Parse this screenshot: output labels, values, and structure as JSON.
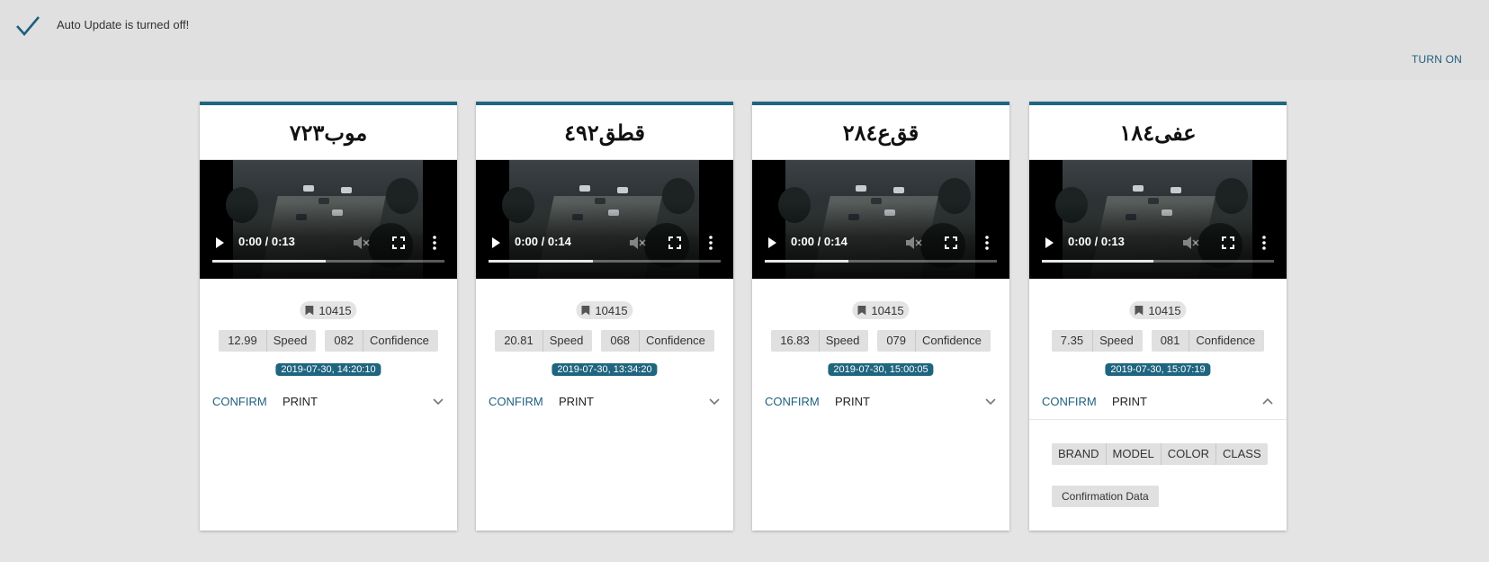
{
  "banner": {
    "message": "Auto Update is turned off!",
    "turn_on_label": "TURN ON",
    "icon": "checkmark-icon"
  },
  "cards": [
    {
      "plate": "موب٧٢٣",
      "video": {
        "time": "0:00 / 0:13",
        "progress": 0.49
      },
      "id": "10415",
      "speed_value": "12.99",
      "speed_label": "Speed",
      "confidence_value": "082",
      "confidence_label": "Confidence",
      "timestamp": "2019-07-30, 14:20:10",
      "confirm_label": "CONFIRM",
      "print_label": "PRINT",
      "expanded": false
    },
    {
      "plate": "قطق٤٩٢",
      "video": {
        "time": "0:00 / 0:14",
        "progress": 0.45
      },
      "id": "10415",
      "speed_value": "20.81",
      "speed_label": "Speed",
      "confidence_value": "068",
      "confidence_label": "Confidence",
      "timestamp": "2019-07-30, 13:34:20",
      "confirm_label": "CONFIRM",
      "print_label": "PRINT",
      "expanded": false
    },
    {
      "plate": "قق‌ع٢٨٤",
      "video": {
        "time": "0:00 / 0:14",
        "progress": 0.36
      },
      "id": "10415",
      "speed_value": "16.83",
      "speed_label": "Speed",
      "confidence_value": "079",
      "confidence_label": "Confidence",
      "timestamp": "2019-07-30, 15:00:05",
      "confirm_label": "CONFIRM",
      "print_label": "PRINT",
      "expanded": false
    },
    {
      "plate": "عفى١٨٤",
      "video": {
        "time": "0:00 / 0:13",
        "progress": 0.48
      },
      "id": "10415",
      "speed_value": "7.35",
      "speed_label": "Speed",
      "confidence_value": "081",
      "confidence_label": "Confidence",
      "timestamp": "2019-07-30, 15:07:19",
      "confirm_label": "CONFIRM",
      "print_label": "PRINT",
      "expanded": true,
      "details": {
        "buttons": [
          "BRAND",
          "MODEL",
          "COLOR",
          "CLASS"
        ],
        "confirmation_label": "Confirmation Data"
      }
    }
  ],
  "colors": {
    "accent": "#1f6580",
    "link": "#1f5f7e",
    "background": "#e4e4e4"
  }
}
